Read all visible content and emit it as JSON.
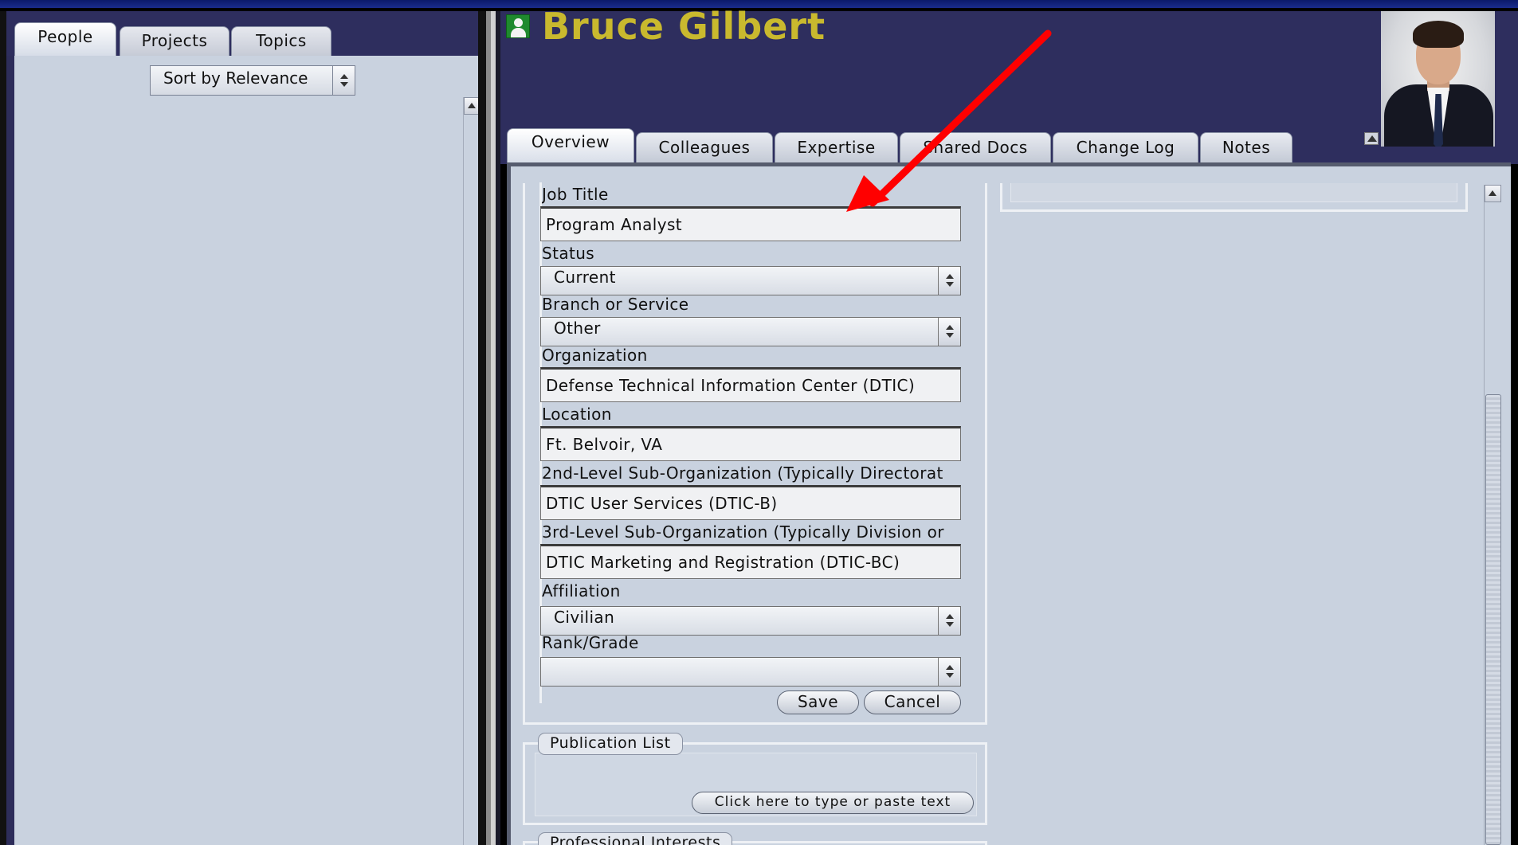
{
  "left_panel": {
    "tabs": [
      {
        "label": "People",
        "active": true
      },
      {
        "label": "Projects",
        "active": false
      },
      {
        "label": "Topics",
        "active": false
      }
    ],
    "sort_select": {
      "value": "Sort by Relevance"
    }
  },
  "header": {
    "person_name": "Bruce Gilbert",
    "name_color": "#c9b92e",
    "background": "#2e2e5e",
    "icons": {
      "person": "person-icon",
      "collapse": "collapse-up-icon"
    }
  },
  "right_tabs": [
    {
      "label": "Overview",
      "active": true
    },
    {
      "label": "Colleagues",
      "active": false
    },
    {
      "label": "Expertise",
      "active": false
    },
    {
      "label": "Shared Docs",
      "active": false
    },
    {
      "label": "Change Log",
      "active": false
    },
    {
      "label": "Notes",
      "active": false
    }
  ],
  "form": {
    "job_title": {
      "label": "Job Title",
      "value": "Program Analyst"
    },
    "status": {
      "label": "Status",
      "value": "Current"
    },
    "branch": {
      "label": "Branch or Service",
      "value": "Other"
    },
    "organization": {
      "label": "Organization",
      "value": "Defense Technical Information Center (DTIC)"
    },
    "location": {
      "label": "Location",
      "value": "Ft. Belvoir, VA"
    },
    "sub_org_2": {
      "label": "2nd-Level Sub-Organization (Typically Directorat",
      "value": "DTIC User Services (DTIC-B)"
    },
    "sub_org_3": {
      "label": "3rd-Level Sub-Organization (Typically Division or",
      "value": "DTIC Marketing and Registration (DTIC-BC)"
    },
    "affiliation": {
      "label": "Affiliation",
      "value": "Civilian"
    },
    "rank": {
      "label": "Rank/Grade",
      "value": ""
    },
    "save_label": "Save",
    "cancel_label": "Cancel"
  },
  "publication_list": {
    "title": "Publication List",
    "paste_button": "Click here to type or paste text"
  },
  "professional_interests": {
    "title": "Professional Interests"
  },
  "annotation": {
    "color": "#ff0000",
    "icon": "red-arrow-annotation"
  }
}
